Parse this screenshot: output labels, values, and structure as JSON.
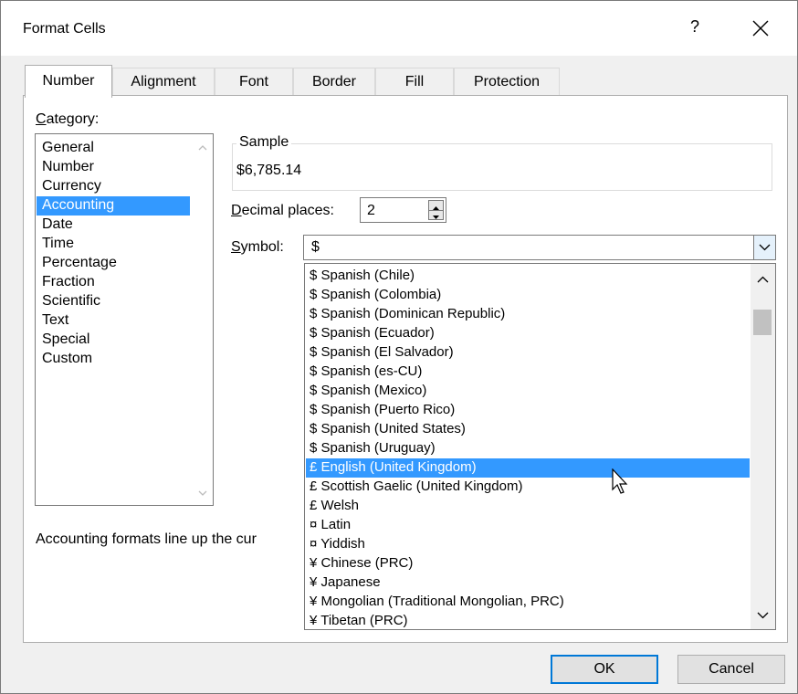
{
  "dialog": {
    "title": "Format Cells",
    "help_label": "?",
    "tabs": [
      "Number",
      "Alignment",
      "Font",
      "Border",
      "Fill",
      "Protection"
    ],
    "active_tab": "Number"
  },
  "category": {
    "label_underlined": "C",
    "label_rest": "ategory:",
    "items": [
      "General",
      "Number",
      "Currency",
      "Accounting",
      "Date",
      "Time",
      "Percentage",
      "Fraction",
      "Scientific",
      "Text",
      "Special",
      "Custom"
    ],
    "selected": "Accounting"
  },
  "sample": {
    "legend": "Sample",
    "value": "$6,785.14"
  },
  "decimal_places": {
    "label_underlined": "D",
    "label_rest": "ecimal places:",
    "value": "2"
  },
  "symbol": {
    "label_underlined": "S",
    "label_rest": "ymbol:",
    "value": "$",
    "options": [
      "$ Spanish (Chile)",
      "$ Spanish (Colombia)",
      "$ Spanish (Dominican Republic)",
      "$ Spanish (Ecuador)",
      "$ Spanish (El Salvador)",
      "$ Spanish (es-CU)",
      "$ Spanish (Mexico)",
      "$ Spanish (Puerto Rico)",
      "$ Spanish (United States)",
      "$ Spanish (Uruguay)",
      "£ English (United Kingdom)",
      "£ Scottish Gaelic (United Kingdom)",
      "£ Welsh",
      "¤ Latin",
      "¤ Yiddish",
      "¥ Chinese (PRC)",
      "¥ Japanese",
      "¥ Mongolian (Traditional Mongolian, PRC)",
      "¥ Tibetan (PRC)"
    ],
    "highlighted": "£ English (United Kingdom)"
  },
  "description": "Accounting formats line up the cur",
  "buttons": {
    "ok": "OK",
    "cancel": "Cancel"
  },
  "colors": {
    "selection": "#3399ff",
    "focus_border": "#0078d7",
    "dialog_bg": "#f0f0f0"
  }
}
